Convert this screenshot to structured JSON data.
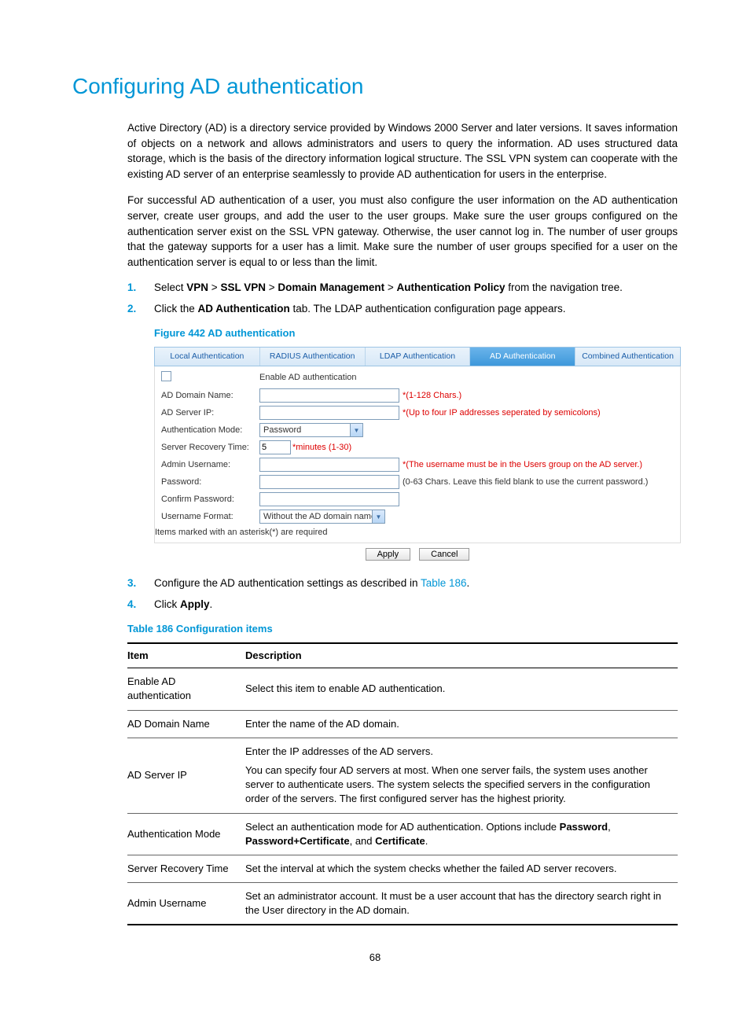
{
  "title": "Configuring AD authentication",
  "para1": "Active Directory (AD) is a directory service provided by Windows 2000 Server and later versions. It saves information of objects on a network and allows administrators and users to query the information. AD uses structured data storage, which is the basis of the directory information logical structure. The SSL VPN system can cooperate with the existing AD server of an enterprise seamlessly to provide AD authentication for users in the enterprise.",
  "para2": "For successful AD authentication of a user, you must also configure the user information on the AD authentication server, create user groups, and add the user to the user groups. Make sure the user groups configured on the authentication server exist on the SSL VPN gateway. Otherwise, the user cannot log in. The number of user groups that the gateway supports for a user has a limit. Make sure the number of user groups specified for a user on the authentication server is equal to or less than the limit.",
  "steps": {
    "s1_pre": "Select ",
    "s1_b1": "VPN",
    "s1_gt1": " > ",
    "s1_b2": "SSL VPN",
    "s1_gt2": " > ",
    "s1_b3": "Domain Management",
    "s1_gt3": " > ",
    "s1_b4": "Authentication Policy",
    "s1_post": " from the navigation tree.",
    "s2_pre": "Click the ",
    "s2_b": "AD Authentication",
    "s2_post": " tab. The LDAP authentication configuration page appears.",
    "s3_pre": "Configure the AD authentication settings as described in ",
    "s3_link": "Table 186",
    "s3_post": ".",
    "s4_pre": "Click ",
    "s4_b": "Apply",
    "s4_post": "."
  },
  "figure_caption": "Figure 442 AD authentication",
  "ui": {
    "tabs": {
      "local": "Local Authentication",
      "radius": "RADIUS Authentication",
      "ldap": "LDAP Authentication",
      "ad": "AD Authentication",
      "combined": "Combined Authentication"
    },
    "rows": {
      "enable_label": "Enable AD authentication",
      "domain_label": "AD Domain Name:",
      "domain_hint": "*(1-128 Chars.)",
      "serverip_label": "AD Server IP:",
      "serverip_hint": "*(Up to four IP addresses seperated by semicolons)",
      "authmode_label": "Authentication Mode:",
      "authmode_value": "Password",
      "recovery_label": "Server Recovery Time:",
      "recovery_value": "5",
      "recovery_unit": "*minutes (1-30)",
      "adminuser_label": "Admin Username:",
      "adminuser_hint": "*(The username must be in the Users group on the AD server.)",
      "password_label": "Password:",
      "password_hint": "(0-63 Chars. Leave this field blank to use the current password.)",
      "confirm_label": "Confirm Password:",
      "userfmt_label": "Username Format:",
      "userfmt_value": "Without the AD domain name"
    },
    "note": "Items marked with an asterisk(*) are required",
    "buttons": {
      "apply": "Apply",
      "cancel": "Cancel"
    }
  },
  "table_caption": "Table 186 Configuration items",
  "table": {
    "head_item": "Item",
    "head_desc": "Description",
    "rows": [
      {
        "item": "Enable AD authentication",
        "desc": "Select this item to enable AD authentication."
      },
      {
        "item": "AD Domain Name",
        "desc": "Enter the name of the AD domain."
      },
      {
        "item": "AD Server IP",
        "desc_line1": "Enter the IP addresses of the AD servers.",
        "desc_line2": "You can specify four AD servers at most. When one server fails, the system uses another server to authenticate users. The system selects the specified servers in the configuration order of the servers. The first configured server has the highest priority."
      },
      {
        "item": "Authentication Mode",
        "desc_pre": "Select an authentication mode for AD authentication. Options include ",
        "b1": "Password",
        "mid": ", ",
        "b2": "Password+Certificate",
        "mid2": ", and ",
        "b3": "Certificate",
        "post": "."
      },
      {
        "item": "Server Recovery Time",
        "desc": "Set the interval at which the system checks whether the failed AD server recovers."
      },
      {
        "item": "Admin Username",
        "desc": "Set an administrator account. It must be a user account that has the directory search right in the User directory in the AD domain."
      }
    ]
  },
  "page_number": "68"
}
